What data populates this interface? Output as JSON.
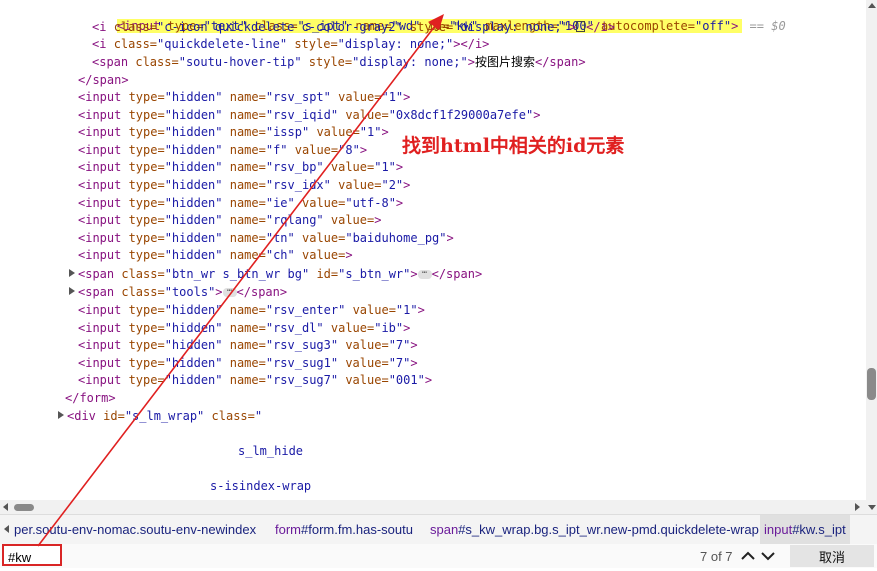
{
  "code": {
    "hl_line": {
      "open": "<input ",
      "a1": "type=",
      "v1": "\"text\"",
      "a2": " class=",
      "v2": "\"s_ipt\"",
      "a3": " name=",
      "v3": "\"wd\"",
      "a4": " id=",
      "v4": "\"kw\"",
      "a5": " maxlength=",
      "v5": "\"100\"",
      "a6": " autocomplete=",
      "v6": "\"off\"",
      "close": ">",
      "eq": " == $0"
    },
    "i1": {
      "open": "<i ",
      "a1": "class=",
      "v1": "\"c-icon quickdelete c-color-gray2\"",
      "a2": " style=",
      "v2": "\"display: none;\"",
      "gt": ">",
      "text": "",
      "close": "</i>"
    },
    "i2": {
      "open": "<i ",
      "a1": "class=",
      "v1": "\"quickdelete-line\"",
      "a2": " style=",
      "v2": "\"display: none;\"",
      "gt": ">",
      "close": "</i>"
    },
    "span_tip": {
      "open": "<span ",
      "a1": "class=",
      "v1": "\"soutu-hover-tip\"",
      "a2": " style=",
      "v2": "\"display: none;\"",
      "gt": ">",
      "text": "按图片搜索",
      "close": "</span>"
    },
    "span_close": "</span>",
    "hidden_inputs": [
      {
        "name": "\"rsv_spt\"",
        "value": "\"1\""
      },
      {
        "name": "\"rsv_iqid\"",
        "value": "\"0x8dcf1f29000a7efe\""
      },
      {
        "name": "\"issp\"",
        "value": "\"1\""
      },
      {
        "name": "\"f\"",
        "value": "\"8\""
      },
      {
        "name": "\"rsv_bp\"",
        "value": "\"1\""
      },
      {
        "name": "\"rsv_idx\"",
        "value": "\"2\""
      },
      {
        "name": "\"ie\"",
        "value": "\"utf-8\""
      },
      {
        "name": "\"rqlang\"",
        "value": ""
      },
      {
        "name": "\"tn\"",
        "value": "\"baiduhome_pg\""
      },
      {
        "name": "\"ch\"",
        "value": ""
      }
    ],
    "hidden_inputs2": [
      {
        "name": "\"rsv_enter\"",
        "value": "\"1\""
      },
      {
        "name": "\"rsv_dl\"",
        "value": "\"ib\""
      },
      {
        "name": "\"rsv_sug3\"",
        "value": "\"7\""
      },
      {
        "name": "\"rsv_sug1\"",
        "value": "\"7\""
      },
      {
        "name": "\"rsv_sug7\"",
        "value": "\"001\""
      }
    ],
    "hidden_tpl": {
      "open": "<input ",
      "type_attr": "type=",
      "type_val": "\"hidden\"",
      "name_attr": " name=",
      "value_attr": " value=",
      "close": ">"
    },
    "span_btn": {
      "open": "<span ",
      "a1": "class=",
      "v1": "\"btn_wr s_btn_wr bg\"",
      "a2": " id=",
      "v2": "\"s_btn_wr\"",
      "gt": ">",
      "dots": "⋯",
      "close": "</span>"
    },
    "span_tools": {
      "open": "<span ",
      "a1": "class=",
      "v1": "\"tools\"",
      "gt": ">",
      "dots": "⋯",
      "close": "</span>"
    },
    "form_close": "</form>",
    "div_lm": {
      "open": "<div ",
      "a1": "id=",
      "v1": "\"s_lm_wrap\"",
      "a2": " class=",
      "v2": "\""
    },
    "cls_line1": "s_lm_hide",
    "cls_line2": "s-isindex-wrap"
  },
  "annotation": "找到html中相关的id元素",
  "breadcrumbs": [
    {
      "tag": "",
      "rest": "per.soutu-env-nomac.soutu-env-newindex"
    },
    {
      "tag": "form",
      "rest": "#form.fm.has-soutu"
    },
    {
      "tag": "span",
      "rest": "#s_kw_wrap.bg.s_ipt_wr.new-pmd.quickdelete-wrap"
    },
    {
      "tag": "input",
      "rest": "#kw.s_ipt"
    }
  ],
  "find": {
    "query": "#kw",
    "count": "7 of 7",
    "cancel_label": "取消"
  },
  "colors": {
    "highlight": "#ffff66",
    "annotation_red": "#e02020",
    "tag": "#881280",
    "attr": "#994500",
    "value": "#1a1aa6"
  }
}
